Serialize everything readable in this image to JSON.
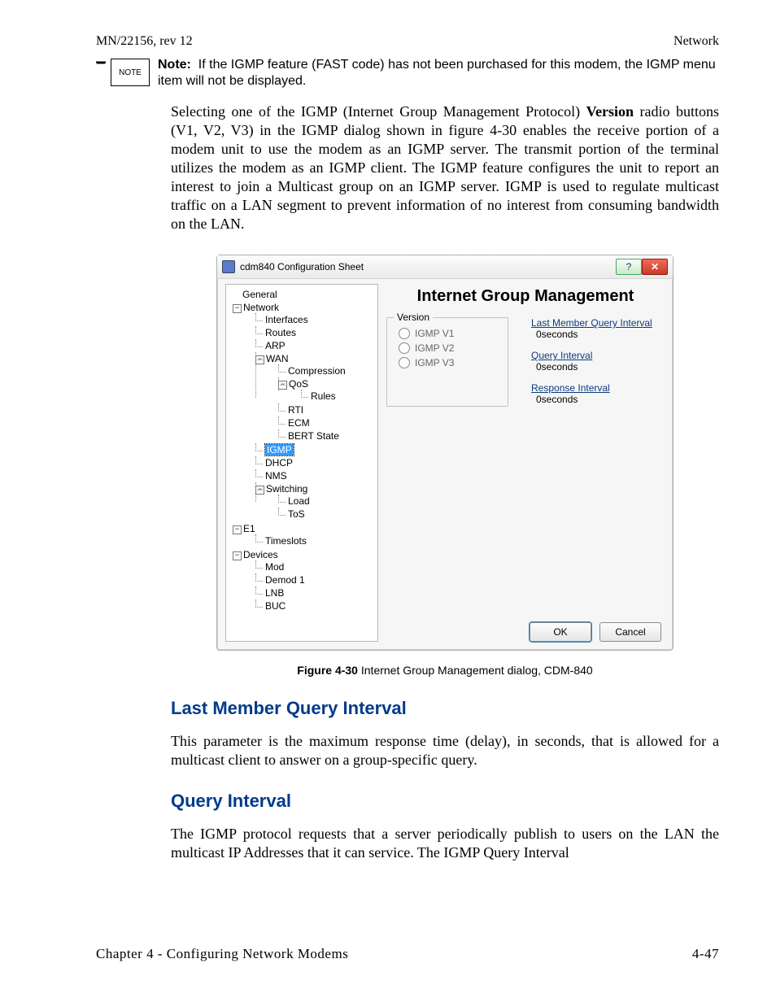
{
  "header": {
    "left": "MN/22156, rev 12",
    "right": "Network"
  },
  "note": {
    "flag": "NOTE",
    "label": "Note:",
    "text": "If the IGMP feature (FAST code) has not been purchased for this modem, the IGMP menu item will not be displayed."
  },
  "para1_pre": "Selecting one of the IGMP (Internet Group Management Protocol) ",
  "para1_bold": "Version",
  "para1_post": " radio buttons (V1, V2, V3) in the IGMP dialog shown in figure 4-30 enables the receive portion of a modem unit to use the modem as an IGMP server. The transmit portion of the terminal utilizes the modem as an IGMP client. The IGMP feature configures the unit to report an interest to join a Multicast group on an IGMP server. IGMP is used to regulate multicast traffic on a LAN segment to prevent information of no interest from consuming bandwidth on the LAN.",
  "dialog": {
    "title": "cdm840 Configuration Sheet",
    "help": "?",
    "close": "✕",
    "panel_title": "Internet Group Management",
    "version_group": "Version",
    "radios": [
      "IGMP V1",
      "IGMP V2",
      "IGMP V3"
    ],
    "info": {
      "last_member_label": "Last Member Query Interval",
      "last_member_value": "0seconds",
      "query_label": "Query Interval",
      "query_value": "0seconds",
      "response_label": "Response Interval",
      "response_value": "0seconds"
    },
    "ok": "OK",
    "cancel": "Cancel",
    "tree": {
      "general": "General",
      "network": "Network",
      "interfaces": "Interfaces",
      "routes": "Routes",
      "arp": "ARP",
      "wan": "WAN",
      "compression": "Compression",
      "qos": "QoS",
      "rules": "Rules",
      "rti": "RTI",
      "ecm": "ECM",
      "bert": "BERT State",
      "igmp": "IGMP",
      "dhcp": "DHCP",
      "nms": "NMS",
      "switching": "Switching",
      "load": "Load",
      "tos": "ToS",
      "e1": "E1",
      "timeslots": "Timeslots",
      "devices": "Devices",
      "mod": "Mod",
      "demod1": "Demod 1",
      "lnb": "LNB",
      "buc": "BUC"
    }
  },
  "figcap": {
    "bold": "Figure 4-30",
    "rest": "   Internet Group Management dialog, CDM-840"
  },
  "h2a": "Last Member Query Interval",
  "para2": "This parameter is the maximum response time (delay), in seconds, that is allowed for a multicast client to answer on a group-specific query.",
  "h2b": "Query Interval",
  "para3": "The IGMP protocol requests that a server periodically publish to users on the LAN the multicast IP Addresses that it can service. The IGMP Query Interval",
  "footer": {
    "left": "Chapter 4 - Configuring Network Modems",
    "right": "4-47"
  }
}
